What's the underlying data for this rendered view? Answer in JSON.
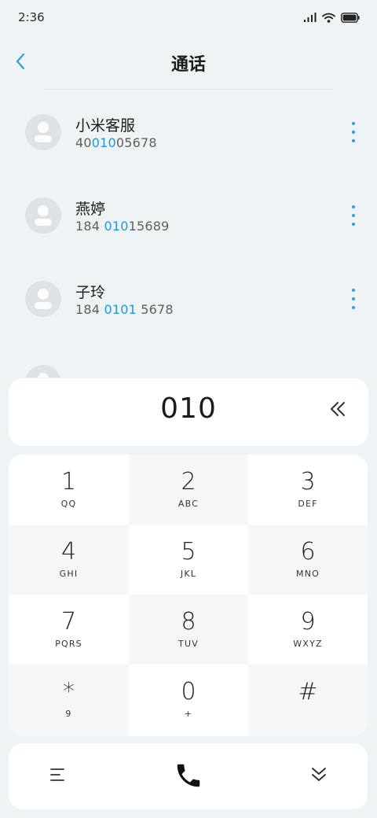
{
  "status_bar": {
    "time": "2:36"
  },
  "header": {
    "title": "通话"
  },
  "contacts": [
    {
      "name": "小米客服",
      "number_pre": "40",
      "number_match": "010",
      "number_post": "05678"
    },
    {
      "name": "燕婷",
      "number_pre": "184 ",
      "number_match": "010",
      "number_post": "15689"
    },
    {
      "name": "子玲",
      "number_pre": "184 ",
      "number_match": "0101",
      "number_post": " 5678"
    }
  ],
  "dialer": {
    "input_value": "010"
  },
  "keypad": {
    "keys": [
      {
        "digit": "1",
        "letters": "QQ"
      },
      {
        "digit": "2",
        "letters": "ABC"
      },
      {
        "digit": "3",
        "letters": "DEF"
      },
      {
        "digit": "4",
        "letters": "GHI"
      },
      {
        "digit": "5",
        "letters": "JKL"
      },
      {
        "digit": "6",
        "letters": "MNO"
      },
      {
        "digit": "7",
        "letters": "PQRS"
      },
      {
        "digit": "8",
        "letters": "TUV"
      },
      {
        "digit": "9",
        "letters": "WXYZ"
      },
      {
        "digit": "*",
        "letters": "9"
      },
      {
        "digit": "0",
        "letters": "+"
      },
      {
        "digit": "#",
        "letters": ""
      }
    ]
  },
  "icons": {
    "back": "chevron-left-icon",
    "more": "more-vertical-icon",
    "backspace": "double-chevron-left-icon",
    "menu": "menu-icon",
    "call": "phone-icon",
    "collapse": "double-chevron-down-icon"
  },
  "colors": {
    "accent": "#1f9ad6",
    "background": "#eef3f6",
    "card": "#ffffff"
  }
}
